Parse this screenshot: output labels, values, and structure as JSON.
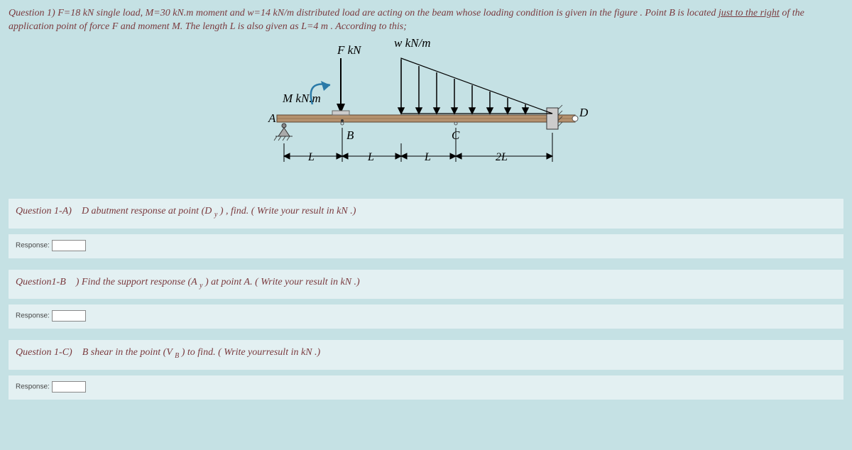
{
  "intro": {
    "q_prefix": "Question 1) F=18 kN",
    "t1": " single load, ",
    "m": "M=30 kN.m",
    "t2": " moment and ",
    "w": "w=14 kN/m",
    "t3": " distributed load are acting on  the beam whose loading condition is given in the figure  . Point B  is located ",
    "under": "just to the right",
    "t4": " of the application point of force F and moment M. The length L is also  given as ",
    "len": "L=4 m",
    "t5": " . According to this;"
  },
  "figure": {
    "w_label": "w kN/m",
    "f_label": "F kN",
    "m_label": "M kN.m",
    "A": "A",
    "B": "B",
    "C": "C",
    "D": "D",
    "L1": "L",
    "L2": "L",
    "L3": "L",
    "L4": "2L"
  },
  "qA": {
    "label": "Question 1-A)",
    "text_pre": "D  abutment response at point  (D ",
    "sub": "y",
    "text_post": " )   , find. ( Write your result in  kN .)"
  },
  "qB": {
    "label": "Question1-B",
    "text_pre": ") Find the support response (A ",
    "sub": "y",
    "text_post": " )  at point  A. ( Write your result in  kN .)"
  },
  "qC": {
    "label": "Question 1-C)",
    "text_pre": "B  shear in the point  (V ",
    "sub": "B",
    "text_post": " )  to find. ( Write yourresult in  kN .)"
  },
  "response_label": "Response:"
}
